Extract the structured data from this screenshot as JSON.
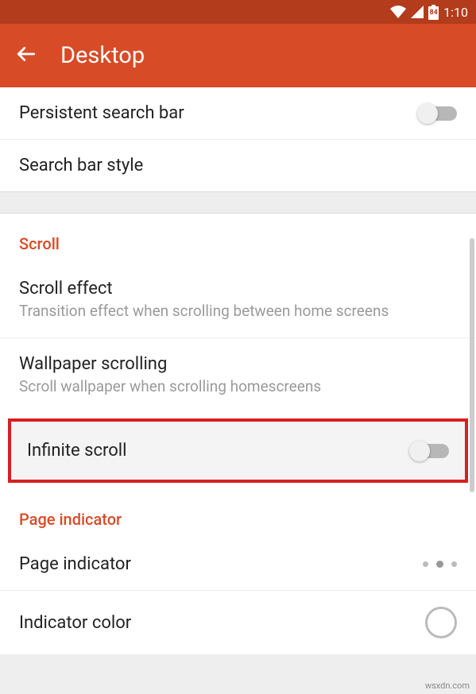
{
  "status": {
    "battery": "84",
    "time": "1:10"
  },
  "header": {
    "title": "Desktop"
  },
  "rows": {
    "persistent_search": {
      "title": "Persistent search bar"
    },
    "search_bar_style": {
      "title": "Search bar style"
    },
    "scroll_header": "Scroll",
    "scroll_effect": {
      "title": "Scroll effect",
      "subtitle": "Transition effect when scrolling between home screens"
    },
    "wallpaper_scrolling": {
      "title": "Wallpaper scrolling",
      "subtitle": "Scroll wallpaper when scrolling homescreens"
    },
    "infinite_scroll": {
      "title": "Infinite scroll"
    },
    "page_indicator_header": "Page indicator",
    "page_indicator": {
      "title": "Page indicator"
    },
    "indicator_color": {
      "title": "Indicator color"
    }
  },
  "watermark": "wsxdn.com"
}
